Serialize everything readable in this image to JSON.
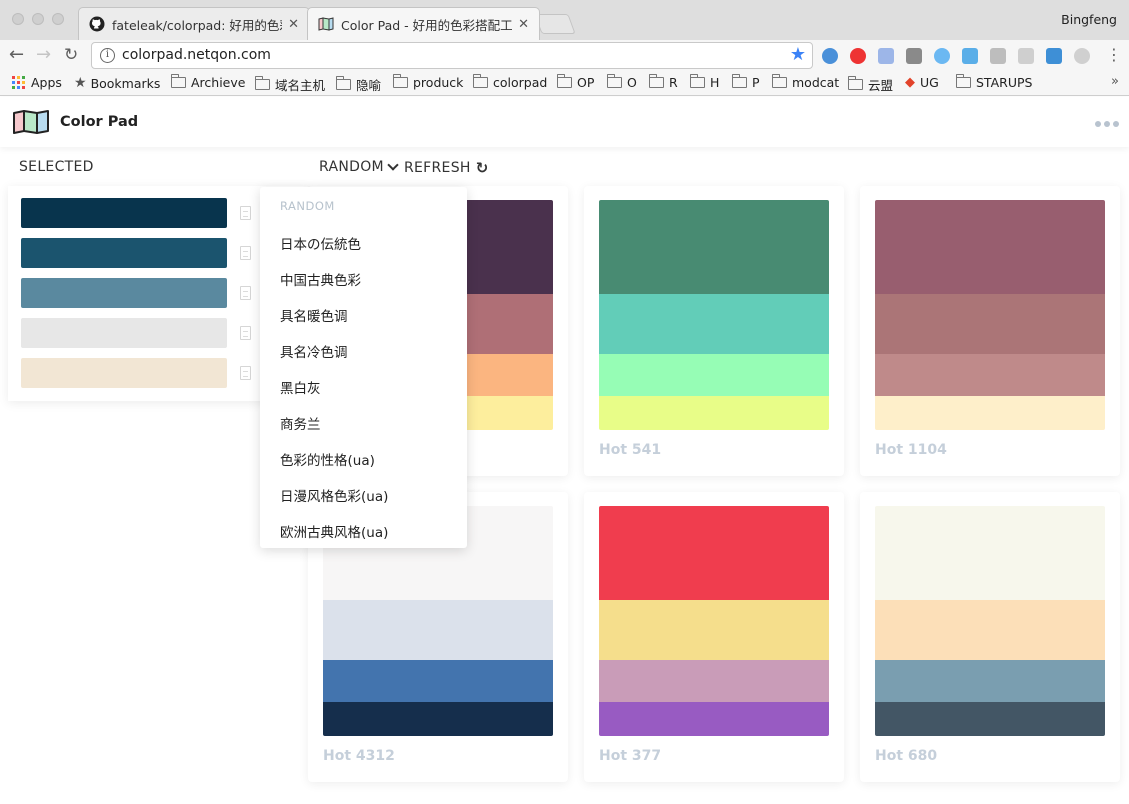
{
  "browser": {
    "tabs": [
      {
        "title": "fateleak/colorpad: 好用的色彩搭配工具",
        "favicon": "github-icon"
      },
      {
        "title": "Color Pad - 好用的色彩搭配工具",
        "favicon": "colorpad-icon"
      }
    ],
    "profile_name": "Bingfeng",
    "url": "colorpad.netqon.com",
    "bookmarks": [
      "Apps",
      "Bookmarks",
      "Archieve",
      "域名主机",
      "隐喻",
      "produck",
      "colorpad",
      "OP",
      "O",
      "R",
      "H",
      "P",
      "modcat",
      "云盟",
      "UG",
      "STARUPS"
    ],
    "bookmarks_overflow": "»"
  },
  "app": {
    "title": "Color Pad",
    "selected_label": "SELECTED",
    "random_label": "RANDOM",
    "refresh_label": "REFRESH",
    "selected_colors": [
      "#08344d",
      "#1b546e",
      "#5a899f",
      "#e7e7e7",
      "#f2e6d4"
    ],
    "dropdown": {
      "header": "RANDOM",
      "items": [
        "日本の伝統色",
        "中国古典色彩",
        "具名暖色调",
        "具名冷色调",
        "黑白灰",
        "商务兰",
        "色彩的性格(ua)",
        "日漫风格色彩(ua)",
        "欧洲古典风格(ua)"
      ]
    },
    "palettes": [
      {
        "label": "",
        "colors": [
          "#4a314d",
          "#af6f76",
          "#fbb580",
          "#fdee9d"
        ]
      },
      {
        "label": "Hot 541",
        "colors": [
          "#488b72",
          "#62cdb8",
          "#96fdb5",
          "#e8fd88"
        ]
      },
      {
        "label": "Hot 1104",
        "colors": [
          "#985e6f",
          "#ab7577",
          "#bf8a8a",
          "#feefca"
        ]
      },
      {
        "label": "Hot 4312",
        "colors": [
          "#f7f6f6",
          "#dbe1eb",
          "#4374ae",
          "#152e4c"
        ]
      },
      {
        "label": "Hot 377",
        "colors": [
          "#f03d4e",
          "#f5de8c",
          "#c99cb8",
          "#985bc2"
        ]
      },
      {
        "label": "Hot 680",
        "colors": [
          "#f7f7ec",
          "#fcdfb8",
          "#7a9eb0",
          "#435665"
        ]
      }
    ]
  }
}
